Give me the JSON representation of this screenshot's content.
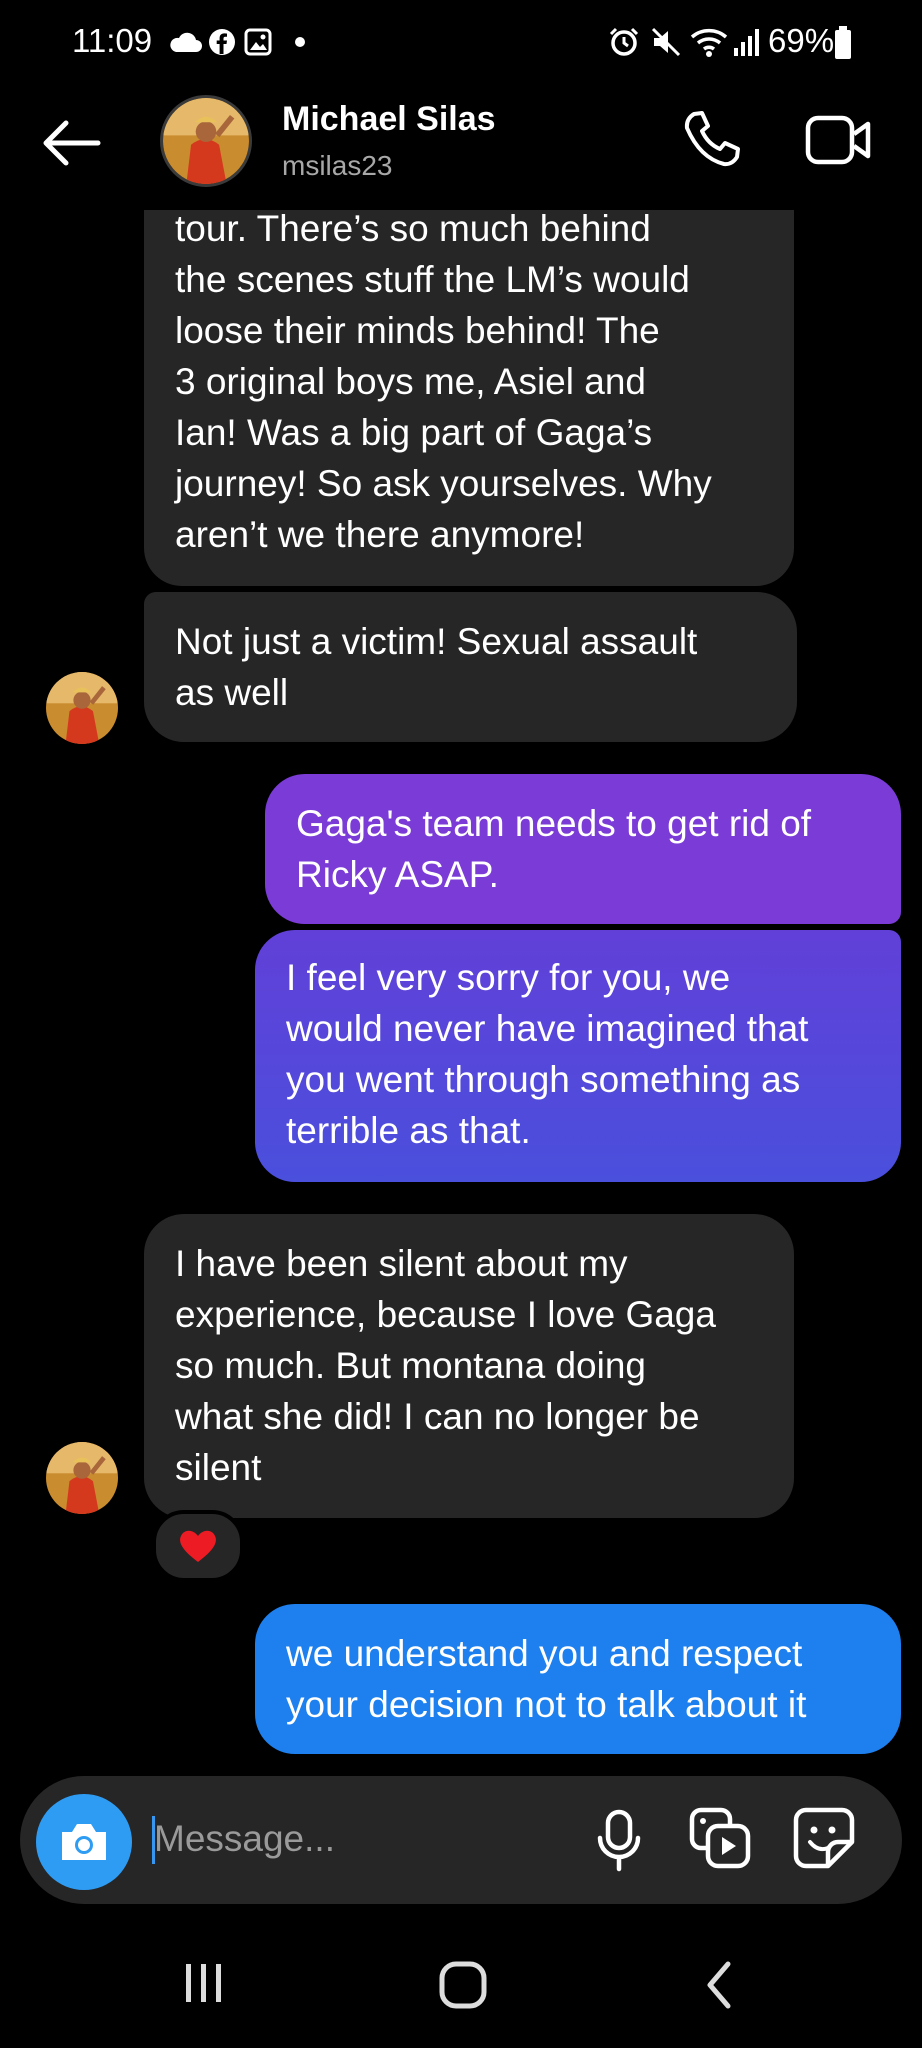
{
  "status_bar": {
    "time": "11:09",
    "battery": "69%",
    "icons": [
      "cloud-icon",
      "facebook-icon",
      "gallery-icon",
      "dot-icon",
      "alarm-icon",
      "mute-icon",
      "wifi-icon",
      "signal-icon",
      "battery-icon"
    ]
  },
  "header": {
    "name": "Michael Silas",
    "username": "msilas23",
    "icons": [
      "back-arrow-icon",
      "phone-icon",
      "video-icon"
    ]
  },
  "messages": [
    {
      "from": "them",
      "lines": [
        "tour. There’s so much behind",
        "the scenes stuff the LM’s would",
        "loose their minds behind! The",
        "3 original boys me, Asiel and",
        "Ian! Was a big part of Gaga’s",
        "journey! So ask yourselves. Why",
        "aren’t we there anymore!"
      ]
    },
    {
      "from": "them",
      "lines": [
        "Not just a victim! Sexual assault",
        "as well"
      ]
    },
    {
      "from": "me",
      "lines": [
        "Gaga's team needs to get rid of",
        "Ricky ASAP."
      ]
    },
    {
      "from": "me",
      "lines": [
        "I feel very sorry for you, we",
        "would never have imagined that",
        "you went through something as",
        "terrible as that."
      ]
    },
    {
      "from": "them",
      "lines": [
        "I have been silent about my",
        "experience, because I love Gaga",
        "so much. But montana doing",
        "what she did! I can no longer be",
        "silent"
      ],
      "reaction": "❤️"
    },
    {
      "from": "me",
      "lines": [
        "we understand you and respect",
        "your decision not to talk about it"
      ]
    }
  ],
  "composer": {
    "placeholder": "Message...",
    "icons": [
      "camera-icon",
      "microphone-icon",
      "gallery-icon",
      "sticker-icon"
    ]
  },
  "colors": {
    "received_bubble": "#262626",
    "sent_top": "#7a3bd6",
    "sent_mid": "#5c47d9",
    "sent_bottom": "#1e80ee",
    "camera_button": "#2f9cf4"
  }
}
